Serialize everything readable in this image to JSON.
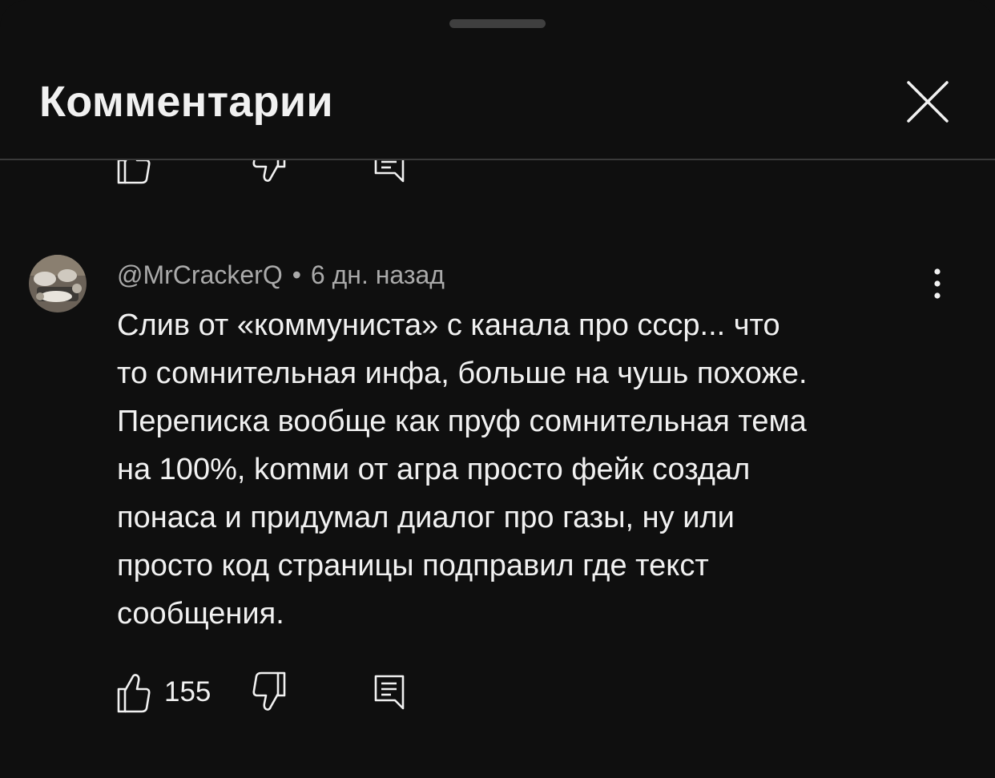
{
  "header": {
    "title": "Комментарии"
  },
  "comment": {
    "author": "@MrCrackerQ",
    "separator": "•",
    "time": "6 дн. назад",
    "text": "Слив от «коммуниста» с канала про ссср... что\nто сомнительная инфа, больше на чушь похоже.\nПереписка вообще как пруф сомнительная тема\nна 100%, komми от агра просто фейк создал\nпонаса и придумал диалог про газы, ну или\nпросто код страницы подправил где текст\nсообщения.",
    "like_count": "155"
  },
  "icons": {
    "close": "close-icon",
    "more": "more-vertical-icon",
    "like": "thumbs-up-icon",
    "dislike": "thumbs-down-icon",
    "reply": "reply-icon"
  },
  "colors": {
    "background": "#0f0f0f",
    "text_primary": "#f1f1f1",
    "text_secondary": "#aaaaaa",
    "divider": "#3a3a3a",
    "handle": "#3f3f3f"
  }
}
